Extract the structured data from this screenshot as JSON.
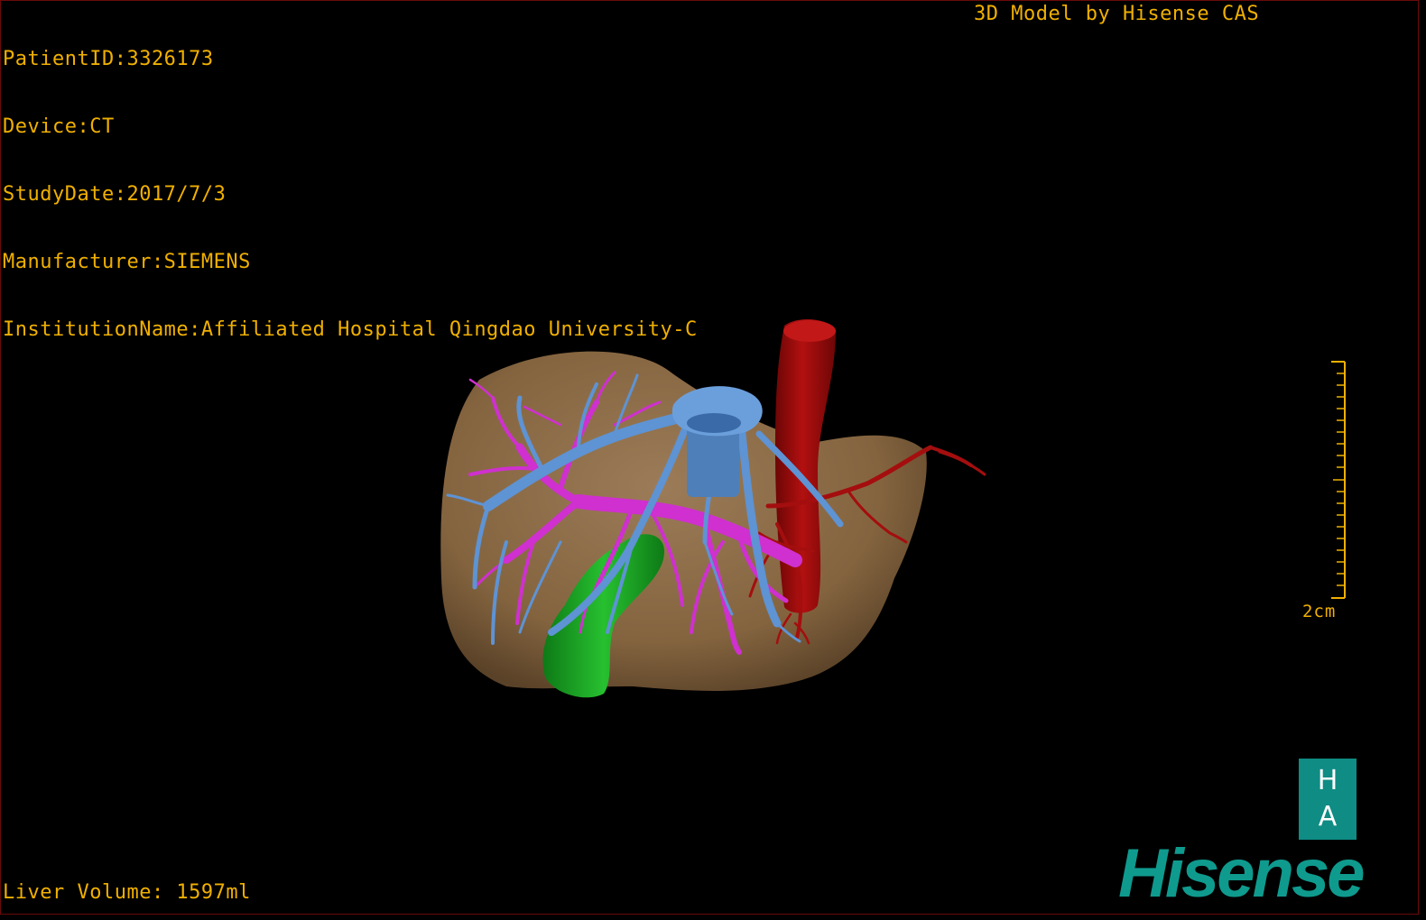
{
  "overlay": {
    "patient_id": "PatientID:3326173",
    "device": "Device:CT",
    "study_date": "StudyDate:2017/7/3",
    "manufacturer": "Manufacturer:SIEMENS",
    "institution": "InstitutionName:Affiliated Hospital Qingdao University-C",
    "title": "3D Model by Hisense CAS",
    "liver_volume": "Liver Volume: 1597ml"
  },
  "scale_bar": {
    "label": "2cm"
  },
  "logo": {
    "box_top": "H",
    "box_bottom": "A",
    "wordmark": "Hisense",
    "color": "#0f8c84"
  },
  "colors": {
    "text": "#f0b000",
    "liver": "#8a6a48",
    "hepatic_vein": "#5b8fd0",
    "portal_vein": "#cc33cc",
    "artery": "#a00c0c",
    "gallbladder": "#1fa82a"
  }
}
